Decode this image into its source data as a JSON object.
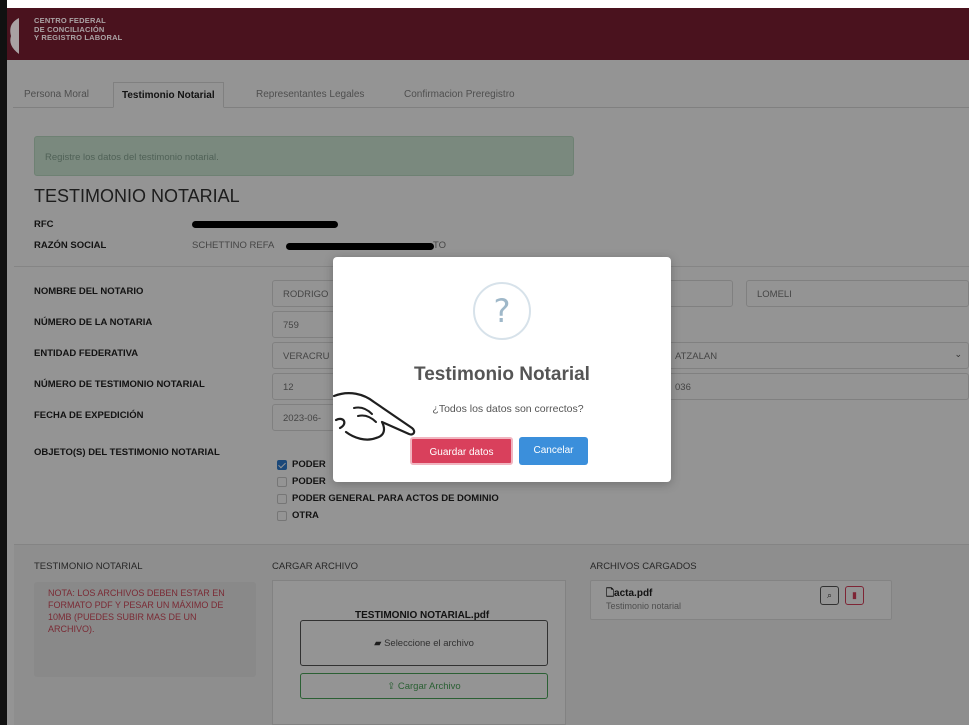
{
  "header": {
    "org_line1": "CENTRO FEDERAL",
    "org_line2": "DE CONCILIACIÓN",
    "org_line3": "Y REGISTRO LABORAL",
    "brand_color": "#6b1a2c"
  },
  "tabs": [
    {
      "label": "Persona Moral",
      "active": false
    },
    {
      "label": "Testimonio Notarial",
      "active": true
    },
    {
      "label": "Representantes Legales",
      "active": false
    },
    {
      "label": "Confirmacion Preregistro",
      "active": false
    }
  ],
  "alert": {
    "text": "Registre los datos del testimonio notarial."
  },
  "section": {
    "title": "TESTIMONIO NOTARIAL",
    "rfc_label": "RFC",
    "razon_label": "RAZÓN SOCIAL",
    "razon_value_start": "SCHETTINO REFA",
    "razon_value_end": "TO"
  },
  "form": {
    "notario_label": "NOMBRE DEL NOTARIO",
    "notario_first": "RODRIGO",
    "notario_last": "LOMELI",
    "notaria_label": "NÚMERO DE LA NOTARIA",
    "notaria_value": "759",
    "entidad_label": "ENTIDAD FEDERATIVA",
    "entidad_value": "VERACRU",
    "municipio_value": "ATZALAN",
    "testimonio_label": "NÚMERO DE TESTIMONIO NOTARIAL",
    "testimonio_value": "12",
    "testimonio_extra": "036",
    "fecha_label": "FECHA DE EXPEDICIÓN",
    "fecha_value": "2023-06-",
    "objeto_label": "OBJETO(S) DEL TESTIMONIO NOTARIAL",
    "objetos": [
      {
        "label": "PODER",
        "checked": true
      },
      {
        "label": "PODER",
        "checked": false
      },
      {
        "label": "PODER GENERAL PARA ACTOS DE DOMINIO",
        "checked": false
      },
      {
        "label": "OTRA",
        "checked": false
      }
    ]
  },
  "files": {
    "col1_title": "TESTIMONIO NOTARIAL",
    "note": "NOTA: LOS ARCHIVOS DEBEN ESTAR EN FORMATO PDF Y PESAR UN MÁXIMO DE 10MB (PUEDES SUBIR MAS DE UN ARCHIVO).",
    "col2_title": "CARGAR ARCHIVO",
    "file_title": "TESTIMONIO NOTARIAL.pdf",
    "select_label": "Seleccione el archivo",
    "upload_label": "Cargar Archivo",
    "col3_title": "ARCHIVOS CARGADOS",
    "uploaded_name": "acta.pdf",
    "uploaded_desc": "Testimonio notarial"
  },
  "modal": {
    "icon": "question-icon",
    "icon_glyph": "?",
    "title": "Testimonio Notarial",
    "text": "¿Todos los datos son correctos?",
    "confirm_label": "Guardar datos",
    "cancel_label": "Cancelar",
    "confirm_color": "#d9405c",
    "cancel_color": "#3b8fdb"
  }
}
